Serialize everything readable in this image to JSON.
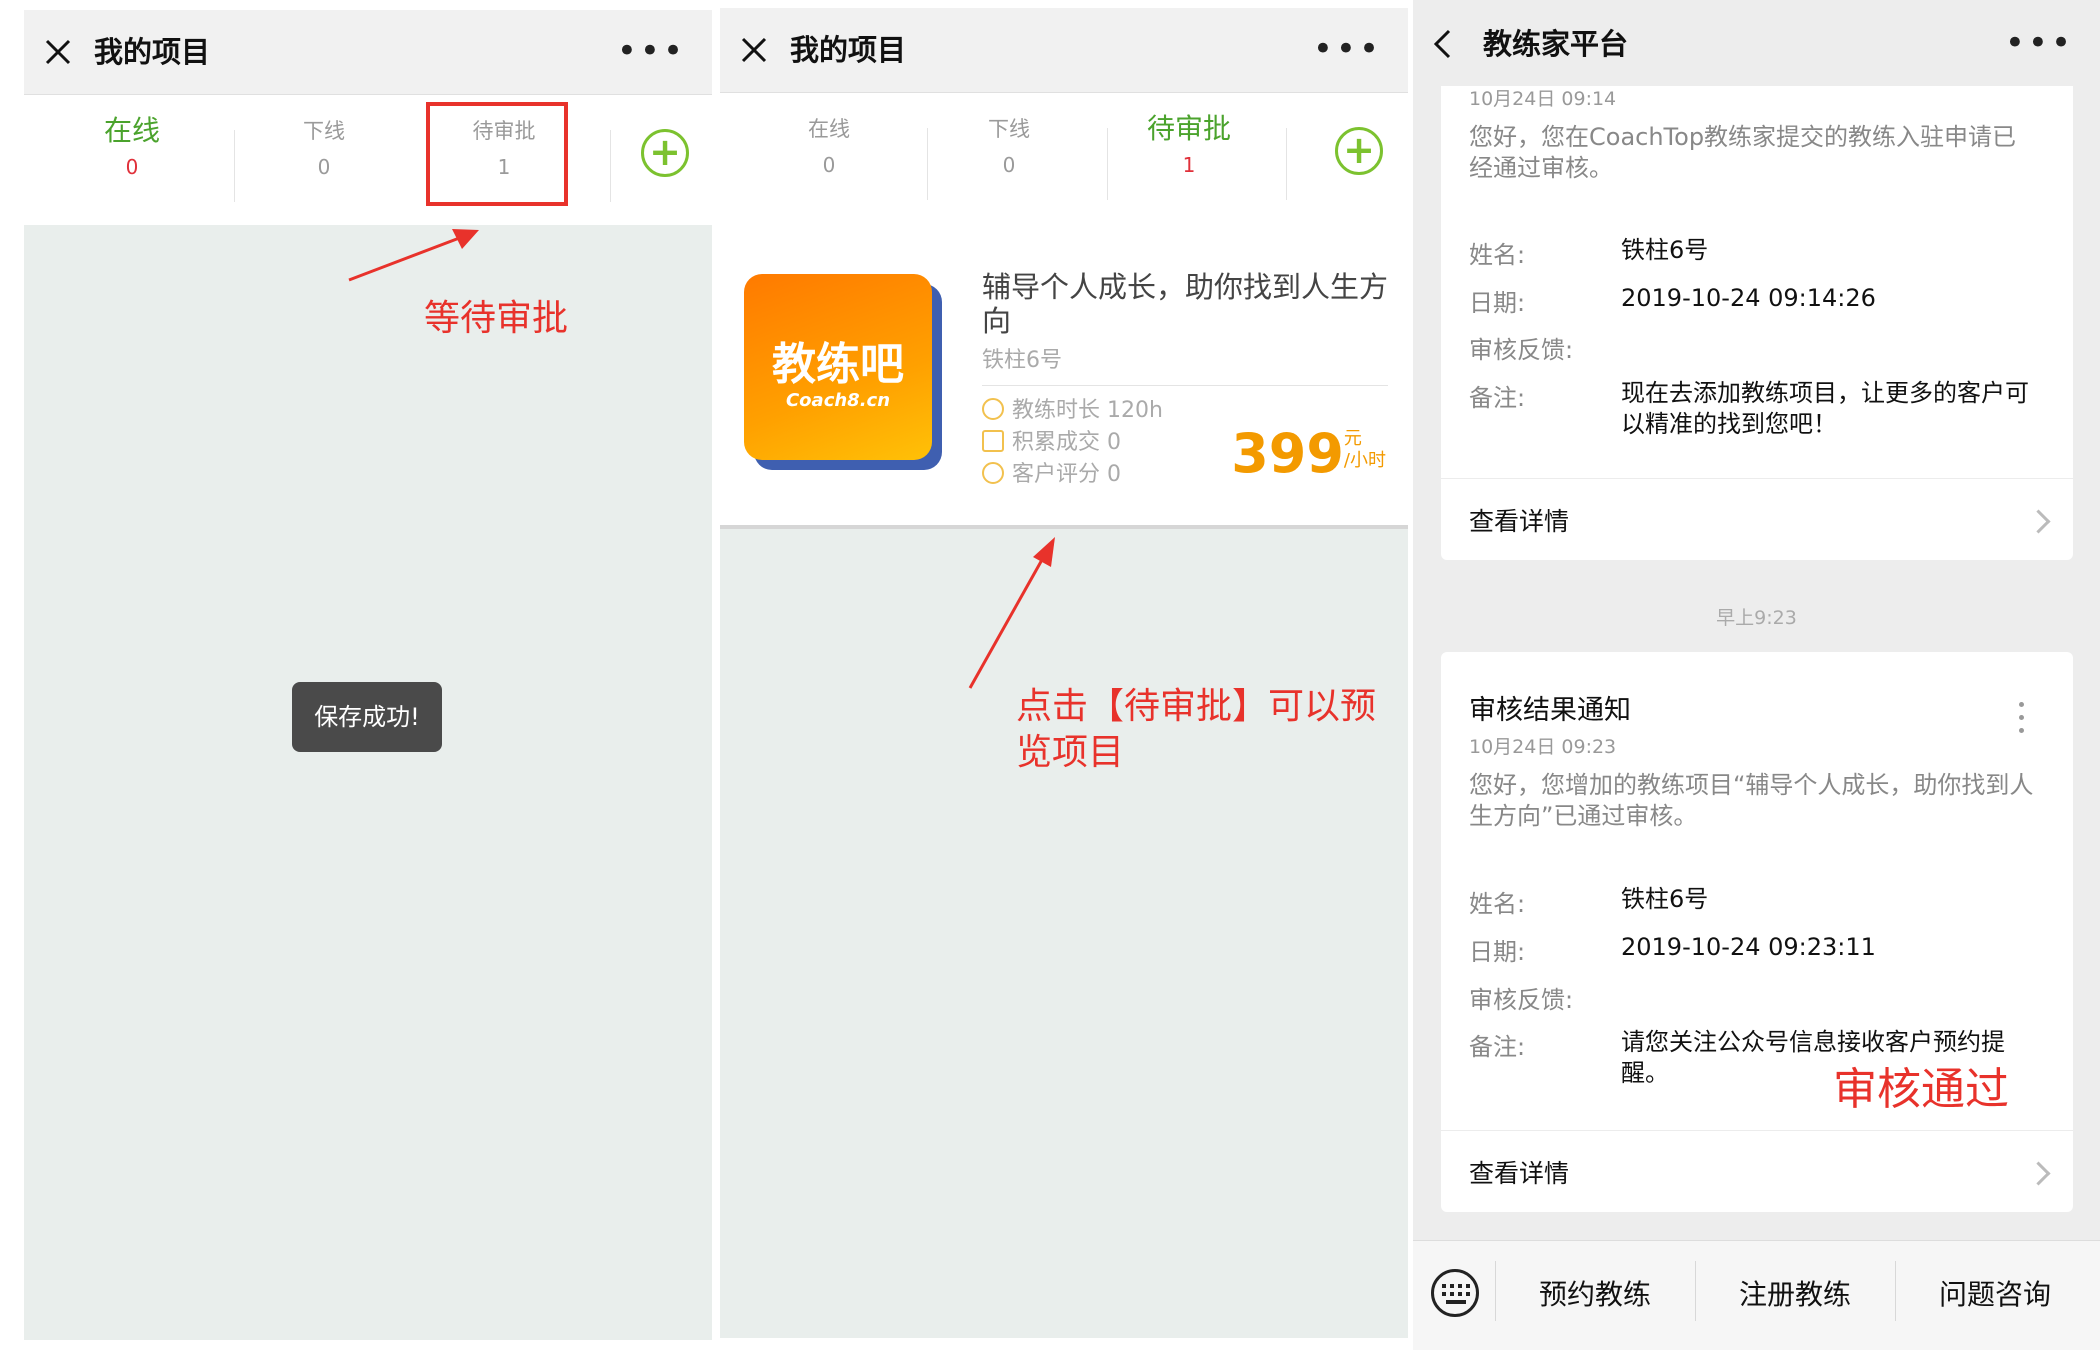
{
  "screen1": {
    "title": "我的项目",
    "tabs": [
      {
        "label": "在线",
        "count": "0"
      },
      {
        "label": "下线",
        "count": "0"
      },
      {
        "label": "待审批",
        "count": "1"
      }
    ],
    "toast": "保存成功!",
    "annotation": "等待审批"
  },
  "screen2": {
    "title": "我的项目",
    "tabs": [
      {
        "label": "在线",
        "count": "0"
      },
      {
        "label": "下线",
        "count": "0"
      },
      {
        "label": "待审批",
        "count": "1"
      }
    ],
    "project": {
      "logo_text": "教练吧",
      "logo_sub": "Coach8.cn",
      "title": "辅导个人成长，助你找到人生方向",
      "author": "铁柱6号",
      "stats": [
        "教练时长 120h",
        "积累成交 0",
        "客户评分 0"
      ],
      "price": "399",
      "price_unit_top": "元",
      "price_unit_bottom": "/小时"
    },
    "annotation": "点击【待审批】可以预览项目"
  },
  "screen3": {
    "title": "教练家平台",
    "msg1": {
      "time": "10月24日 09:14",
      "body": "您好，您在CoachTop教练家提交的教练入驻申请已经通过审核。",
      "name_label": "姓名:",
      "name": "铁柱6号",
      "date_label": "日期:",
      "date": "2019-10-24 09:14:26",
      "feedback_label": "审核反馈:",
      "note_label": "备注:",
      "note": "现在去添加教练项目，让更多的客户可以精准的找到您吧！",
      "detail": "查看详情"
    },
    "timestamp": "早上9:23",
    "msg2": {
      "title": "审核结果通知",
      "time": "10月24日 09:23",
      "body": "您好，您增加的教练项目“辅导个人成长，助你找到人生方向”已通过审核。",
      "name_label": "姓名:",
      "name": "铁柱6号",
      "date_label": "日期:",
      "date": "2019-10-24 09:23:11",
      "feedback_label": "审核反馈:",
      "note_label": "备注:",
      "note": "请您关注公众号信息接收客户预约提醒。",
      "detail": "查看详情"
    },
    "annotation": "审核通过",
    "menu": [
      "预约教练",
      "注册教练",
      "问题咨询"
    ]
  },
  "colors": {
    "green": "#4ba32d",
    "red_annotation": "#e8322b",
    "price_orange": "#f39a00"
  }
}
